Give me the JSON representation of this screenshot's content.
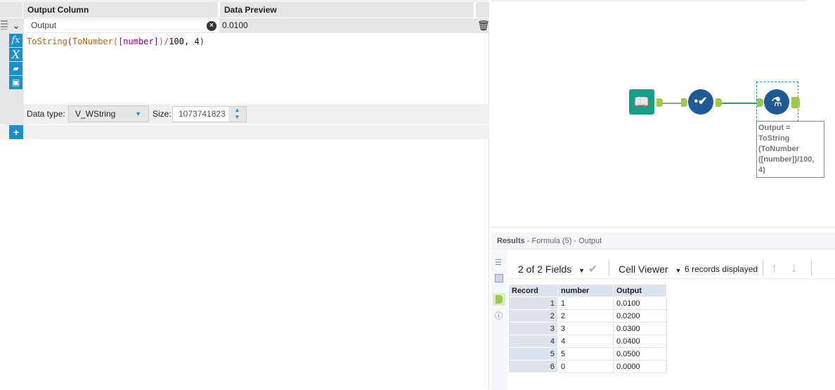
{
  "formula_panel": {
    "headers": {
      "output_column": "Output Column",
      "data_preview": "Data Preview"
    },
    "row": {
      "field": "Output",
      "preview": "0.0100"
    },
    "expression": {
      "fn1": "ToString",
      "p1": "(",
      "fn2": "ToNumber",
      "p2": "(",
      "field": "[number]",
      "p3": ")",
      "op": "/",
      "rest": "100, 4",
      "p4": ")"
    },
    "data_type_label": "Data type:",
    "data_type_value": "V_WString",
    "size_label": "Size:",
    "size_value": "1073741823"
  },
  "canvas": {
    "annotation": "Output = ToString (ToNumber ([number])/100, 4)"
  },
  "results": {
    "title": "Results",
    "subtitle": "- Formula (5) - Output",
    "fields_label": "2 of 2 Fields",
    "cell_viewer": "Cell Viewer",
    "records": "6 records displayed",
    "columns": [
      "Record",
      "number",
      "Output"
    ],
    "rows": [
      [
        "1",
        "1",
        "0.0100"
      ],
      [
        "2",
        "2",
        "0.0200"
      ],
      [
        "3",
        "3",
        "0.0300"
      ],
      [
        "4",
        "4",
        "0.0400"
      ],
      [
        "5",
        "5",
        "0.0500"
      ],
      [
        "6",
        "0",
        "0.0000"
      ]
    ]
  }
}
